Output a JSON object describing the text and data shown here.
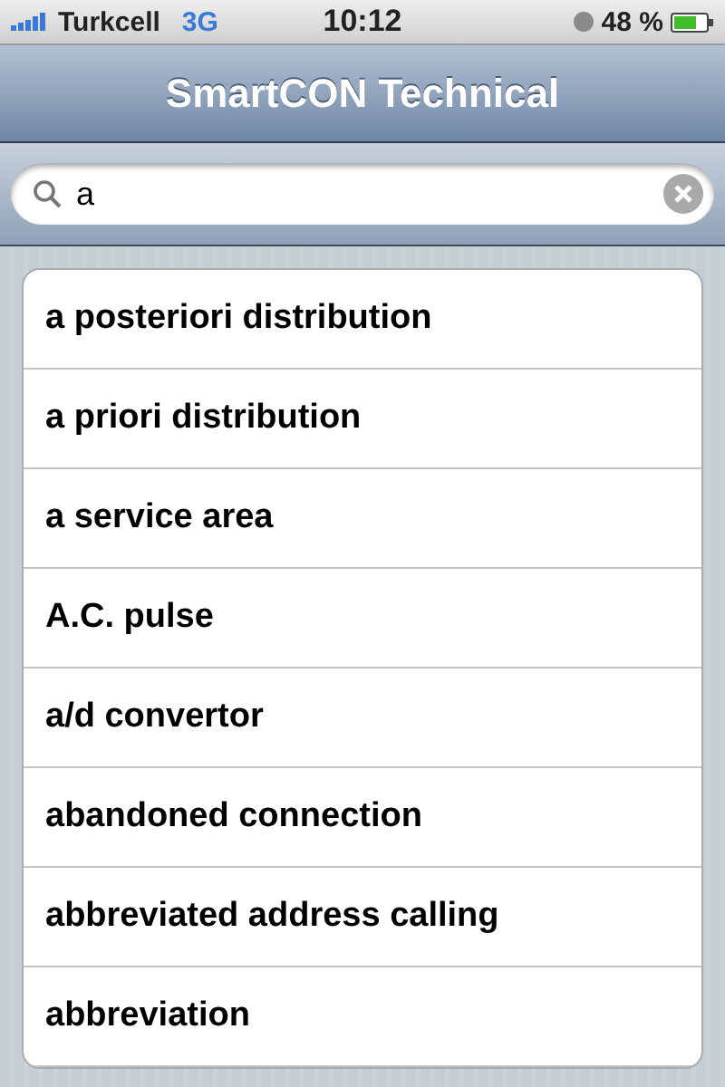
{
  "status_bar": {
    "carrier": "Turkcell",
    "network": "3G",
    "time": "10:12",
    "battery": "48 %"
  },
  "nav_bar": {
    "title": "SmartCON Technical"
  },
  "search": {
    "value": "a"
  },
  "results": [
    {
      "label": "a posteriori distribution"
    },
    {
      "label": "a priori distribution"
    },
    {
      "label": "a service area"
    },
    {
      "label": "A.C. pulse"
    },
    {
      "label": "a/d convertor"
    },
    {
      "label": "abandoned connection"
    },
    {
      "label": "abbreviated address calling"
    },
    {
      "label": "abbreviation"
    }
  ]
}
